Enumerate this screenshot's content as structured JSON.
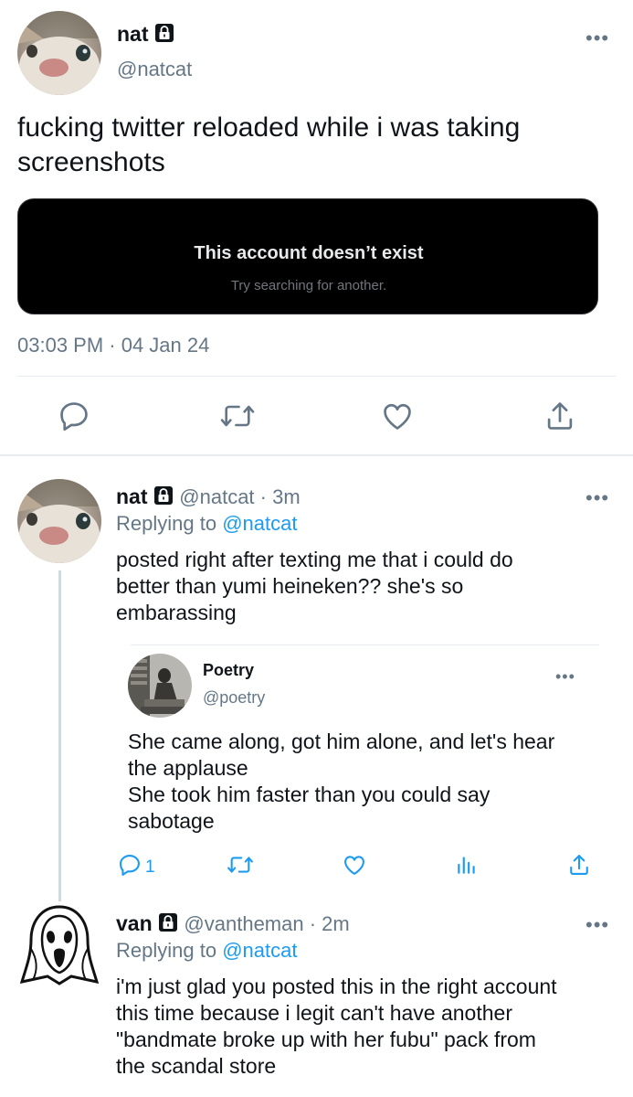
{
  "main_tweet": {
    "name": "nat",
    "handle": "@natcat",
    "text_line1": "fucking twitter reloaded while i was taking",
    "text_line2": "screenshots",
    "embed_title": "This account doesn’t exist",
    "embed_subtitle": "Try searching for another.",
    "timestamp": "03:03 PM · 04 Jan 24",
    "more_label": "•••"
  },
  "reply1": {
    "name": "nat",
    "handle_time": "@natcat · 3m",
    "replying_prefix": "Replying to",
    "replying_handle": "@natcat",
    "text_line1": "posted right after texting me that i could do",
    "text_line2": "better than yumi heineken?? she's so",
    "text_line3": "embarassing",
    "more_label": "•••"
  },
  "quoted": {
    "name": "Poetry",
    "handle": "@poetry",
    "text_line1": "She came along, got him alone, and let's hear",
    "text_line2": "the applause",
    "text_line3": "She took him faster than you could say",
    "text_line4": "sabotage",
    "reply_count": "1",
    "more_label": "•••"
  },
  "reply2": {
    "name": "van",
    "handle_time": "@vantheman · 2m",
    "replying_prefix": "Replying to",
    "replying_handle": "@natcat",
    "text_line1": "i'm just glad you posted this in the right account",
    "text_line2": "this time because i legit can't have another",
    "text_line3": "\"bandmate broke up with her fubu\" pack from",
    "text_line4": "the scandal store",
    "more_label": "•••"
  },
  "colors": {
    "accent": "#1d9bf0",
    "secondary_text": "#657786",
    "divider": "#e6ecf0",
    "thread_line": "#cfd9de"
  },
  "icons": [
    "lock-icon",
    "reply-icon",
    "retweet-icon",
    "like-icon",
    "share-icon",
    "analytics-icon",
    "more-icon"
  ]
}
